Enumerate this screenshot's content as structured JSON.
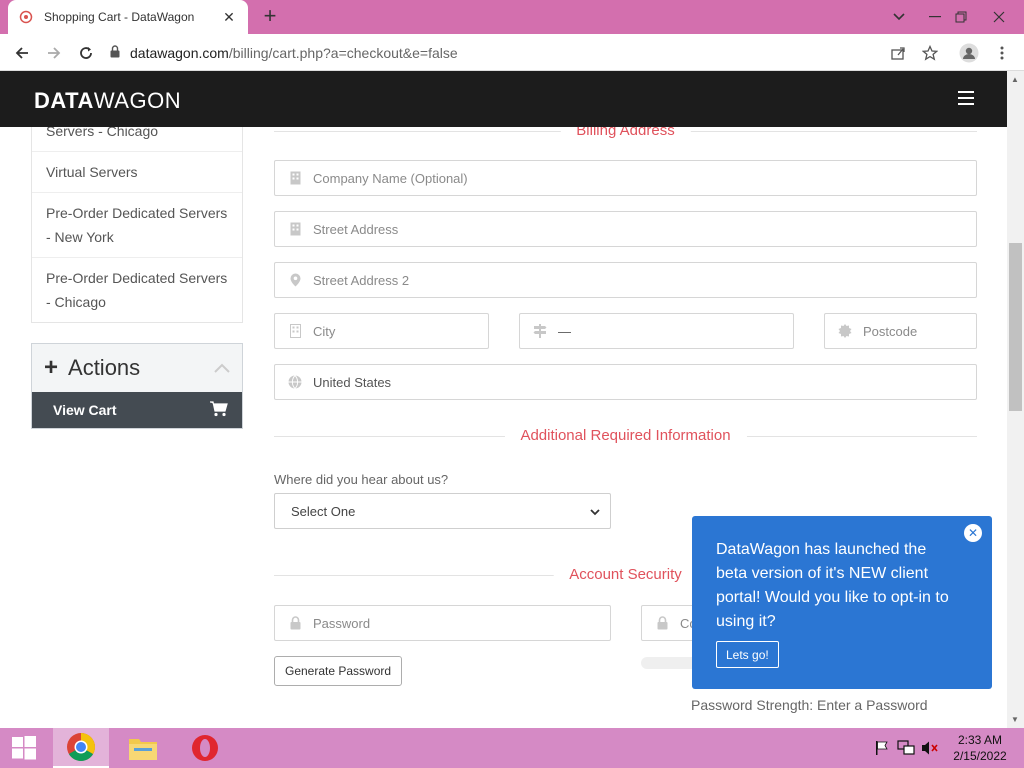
{
  "browser": {
    "tab_title": "Shopping Cart - DataWagon",
    "url_host": "datawagon.com",
    "url_path": "/billing/cart.php?a=checkout&e=false",
    "new_tab_icon": "plus-icon",
    "window_controls": [
      "chevron-down-icon",
      "minimize-icon",
      "restore-icon",
      "close-icon"
    ]
  },
  "site": {
    "logo_bold": "DATA",
    "logo_light": "WAGON"
  },
  "sidebar": {
    "items": [
      {
        "label": "Servers - Chicago"
      },
      {
        "label": "Virtual Servers"
      },
      {
        "label": "Pre-Order Dedicated Servers - New York"
      },
      {
        "label": "Pre-Order Dedicated Servers - Chicago"
      }
    ],
    "actions_title": "Actions",
    "view_cart_label": "View Cart"
  },
  "billing": {
    "section_title": "Billing Address",
    "company_placeholder": "Company Name (Optional)",
    "street_placeholder": "Street Address",
    "street2_placeholder": "Street Address 2",
    "city_placeholder": "City",
    "state_value": "—",
    "postcode_placeholder": "Postcode",
    "country_value": "United States"
  },
  "additional": {
    "section_title": "Additional Required Information",
    "hear_label": "Where did you hear about us?",
    "hear_selected": "Select One"
  },
  "security": {
    "section_title": "Account Security",
    "password_placeholder": "Password",
    "confirm_placeholder": "Co",
    "generate_label": "Generate Password",
    "strength_text": "Password Strength: Enter a Password"
  },
  "popup": {
    "message": "DataWagon has launched the beta version of it's NEW client portal! Would you like to opt-in to using it?",
    "button_label": "Lets go!"
  },
  "taskbar": {
    "time": "2:33 AM",
    "date": "2/15/2022"
  }
}
